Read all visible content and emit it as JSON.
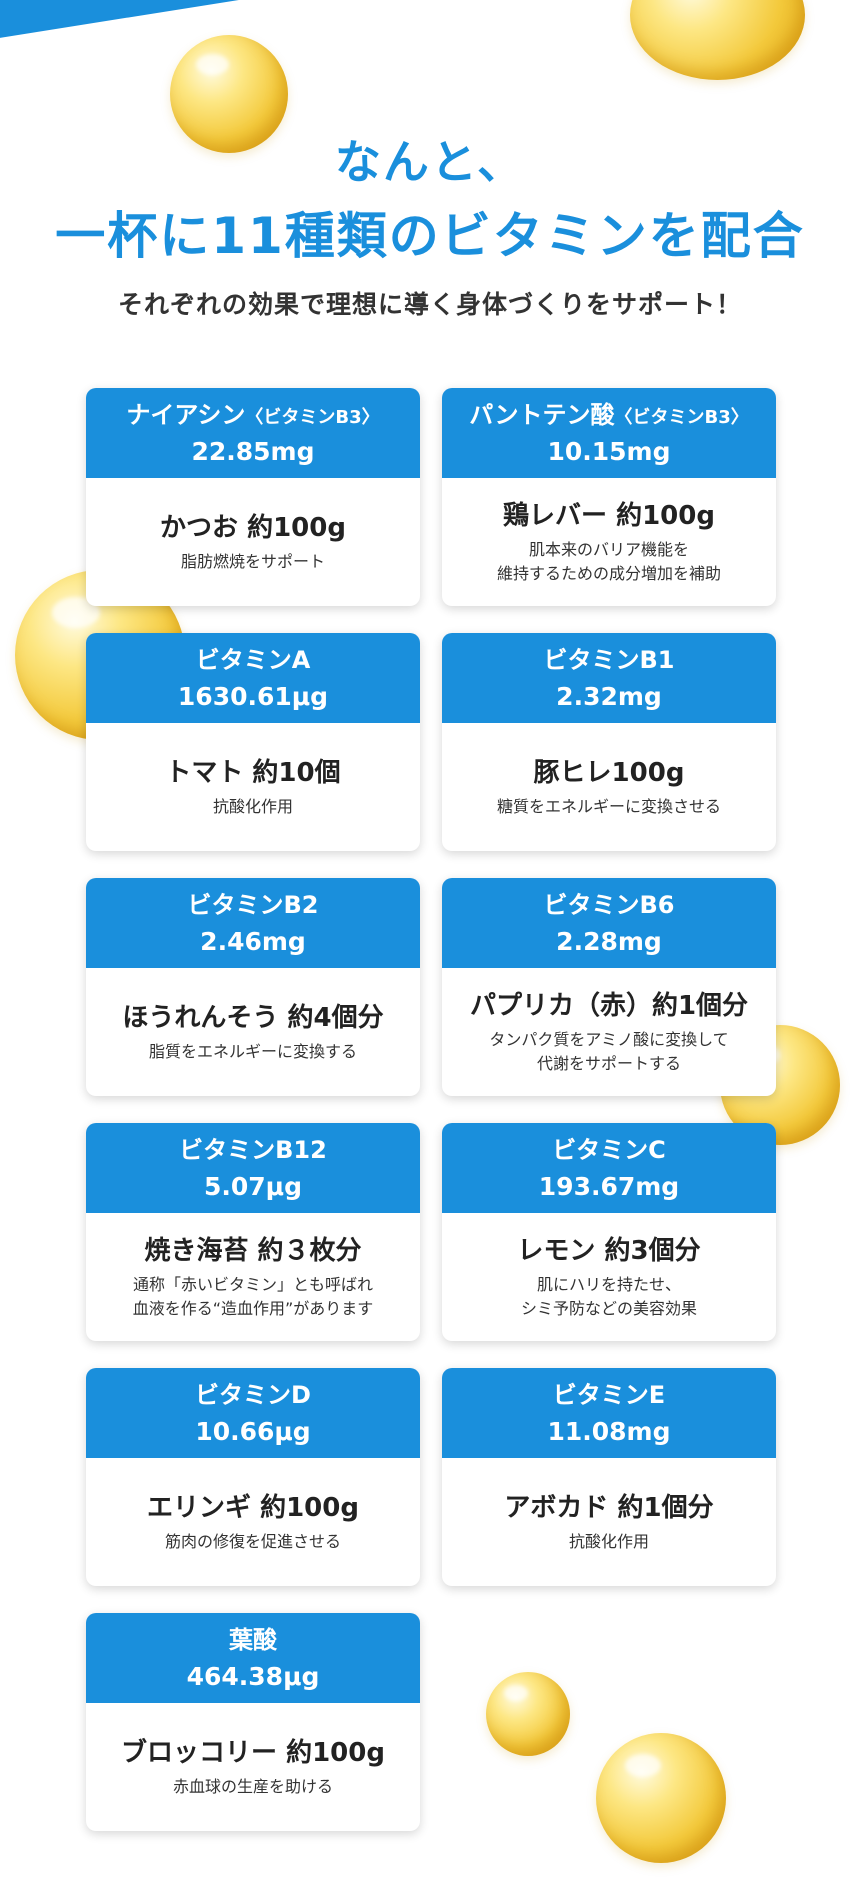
{
  "headline": {
    "line1": "なんと、",
    "line2": "一杯に11種類のビタミンを配合"
  },
  "subheadline": "それぞれの効果で理想に導く身体づくりをサポート！",
  "vitamins": [
    {
      "name": "ナイアシン",
      "note": "〈ビタミンB3〉",
      "amount": "22.85mg",
      "food": "かつお 約100g",
      "effect": "脂肪燃焼をサポート"
    },
    {
      "name": "パントテン酸",
      "note": "〈ビタミンB3〉",
      "amount": "10.15mg",
      "food": "鶏レバー 約100g",
      "effect": "肌本来のバリア機能を\n維持するための成分増加を補助"
    },
    {
      "name": "ビタミンA",
      "note": "",
      "amount": "1630.61μg",
      "food": "トマト 約10個",
      "effect": "抗酸化作用"
    },
    {
      "name": "ビタミンB1",
      "note": "",
      "amount": "2.32mg",
      "food": "豚ヒレ100g",
      "effect": "糖質をエネルギーに変換させる"
    },
    {
      "name": "ビタミンB2",
      "note": "",
      "amount": "2.46mg",
      "food": "ほうれんそう 約4個分",
      "effect": "脂質をエネルギーに変換する"
    },
    {
      "name": "ビタミンB6",
      "note": "",
      "amount": "2.28mg",
      "food": "パプリカ（赤）約1個分",
      "effect": "タンパク質をアミノ酸に変換して\n代謝をサポートする"
    },
    {
      "name": "ビタミンB12",
      "note": "",
      "amount": "5.07μg",
      "food": "焼き海苔 約３枚分",
      "effect": "通称「赤いビタミン」とも呼ばれ\n血液を作る“造血作用”があります"
    },
    {
      "name": "ビタミンC",
      "note": "",
      "amount": "193.67mg",
      "food": "レモン 約3個分",
      "effect": "肌にハリを持たせ、\nシミ予防などの美容効果"
    },
    {
      "name": "ビタミンD",
      "note": "",
      "amount": "10.66μg",
      "food": "エリンギ 約100g",
      "effect": "筋肉の修復を促進させる"
    },
    {
      "name": "ビタミンE",
      "note": "",
      "amount": "11.08mg",
      "food": "アボカド 約1個分",
      "effect": "抗酸化作用"
    },
    {
      "name": "葉酸",
      "note": "",
      "amount": "464.38μg",
      "food": "ブロッコリー 約100g",
      "effect": "赤血球の生産を助ける"
    }
  ],
  "colors": {
    "accent": "#1a8fdc",
    "bubble": "#f3c93b"
  }
}
